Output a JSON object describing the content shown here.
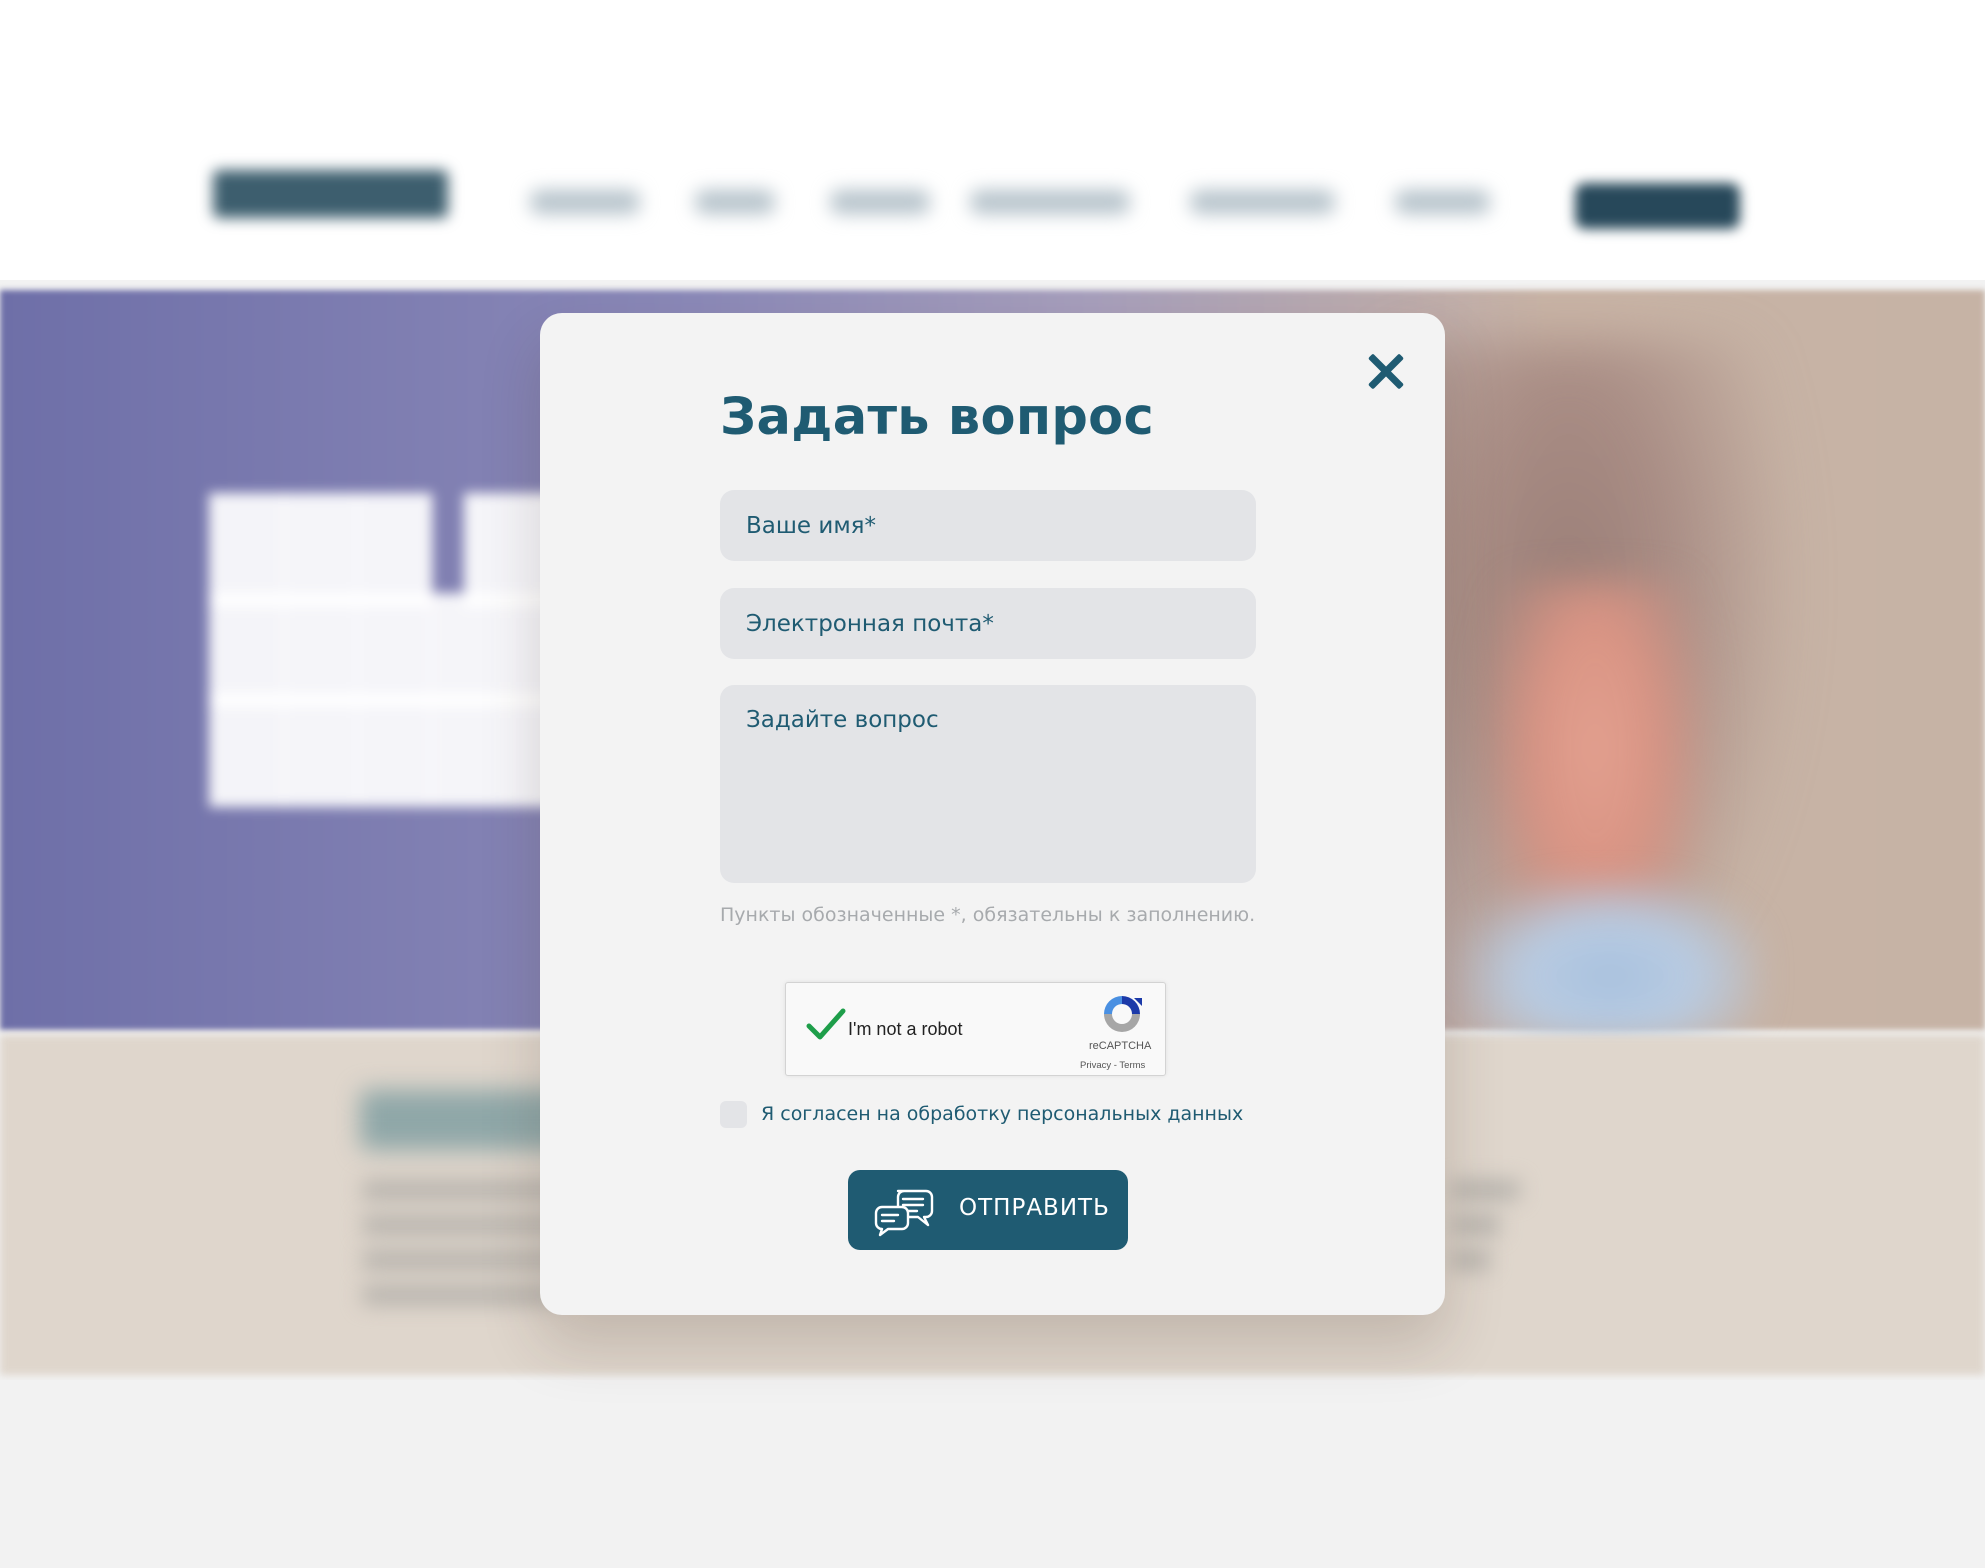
{
  "modal": {
    "title": "Задать вопрос",
    "close_icon": "close-icon",
    "fields": {
      "name_placeholder": "Ваше имя*",
      "email_placeholder": "Электронная почта*",
      "question_placeholder": "Задайте вопрос"
    },
    "hint": "Пункты обозначенные *, обязательны к заполнению.",
    "recaptcha": {
      "label": "I'm not a robot",
      "brand": "reCAPTCHA",
      "links": "Privacy - Terms",
      "checked": true,
      "check_color": "#1e9e4a"
    },
    "consent": {
      "label": "Я согласен на обработку персональных данных",
      "checked": false
    },
    "submit": {
      "label": "ОТПРАВИТЬ",
      "icon": "chat-bubbles-icon"
    }
  },
  "colors": {
    "accent": "#1f5b72",
    "field_bg": "#e3e4e7",
    "modal_bg": "#f3f3f3",
    "hint": "#a7aaad"
  }
}
